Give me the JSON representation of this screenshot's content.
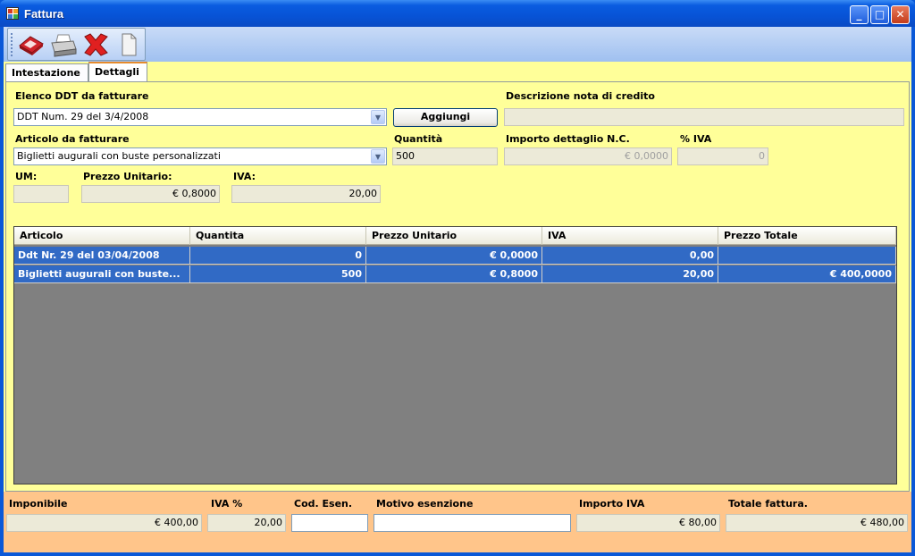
{
  "window": {
    "title": "Fattura"
  },
  "toolbar": {
    "items": [
      {
        "name": "save-icon",
        "color": "#d0232a"
      },
      {
        "name": "print-icon",
        "color": "#9a9a9a"
      },
      {
        "name": "delete-icon",
        "color": "#e02020"
      },
      {
        "name": "new-document-icon",
        "color": "#f4f4f4"
      }
    ]
  },
  "tabs": [
    {
      "label": "Intestazione",
      "active": false
    },
    {
      "label": "Dettagli",
      "active": true
    }
  ],
  "form": {
    "ddt_label": "Elenco DDT da fatturare",
    "ddt_value": "DDT Num. 29 del 3/4/2008",
    "add_button": "Aggiungi",
    "credit_note_label": "Descrizione nota di credito",
    "credit_note_value": "",
    "article_label": "Articolo da fatturare",
    "article_value": "Biglietti augurali con buste personalizzati",
    "quantity_label": "Quantità",
    "quantity_value": "500",
    "nc_amount_label": "Importo dettaglio N.C.",
    "nc_amount_value": "€ 0,0000",
    "vat_pct_label": "% IVA",
    "vat_pct_value": "0",
    "um_label": "UM:",
    "um_value": "",
    "unit_price_label": "Prezzo Unitario:",
    "unit_price_value": "€ 0,8000",
    "vat_label": "IVA:",
    "vat_value": "20,00"
  },
  "grid": {
    "columns": [
      "Articolo",
      "Quantita",
      "Prezzo Unitario",
      "IVA",
      "Prezzo Totale"
    ],
    "rows": [
      [
        "Ddt Nr. 29 del 03/04/2008",
        "0",
        "€ 0,0000",
        "0,00",
        ""
      ],
      [
        "Biglietti augurali con buste...",
        "500",
        "€ 0,8000",
        "20,00",
        "€ 400,0000"
      ]
    ],
    "selection_color": "#316ac5"
  },
  "footer": {
    "imponibile_label": "Imponibile",
    "imponibile_value": "€ 400,00",
    "iva_pct_label": "IVA %",
    "iva_pct_value": "20,00",
    "cod_esen_label": "Cod. Esen.",
    "cod_esen_value": "",
    "motivo_label": "Motivo esenzione",
    "motivo_value": "",
    "importo_iva_label": "Importo IVA",
    "importo_iva_value": "€ 80,00",
    "totale_label": "Totale fattura.",
    "totale_value": "€ 480,00"
  }
}
